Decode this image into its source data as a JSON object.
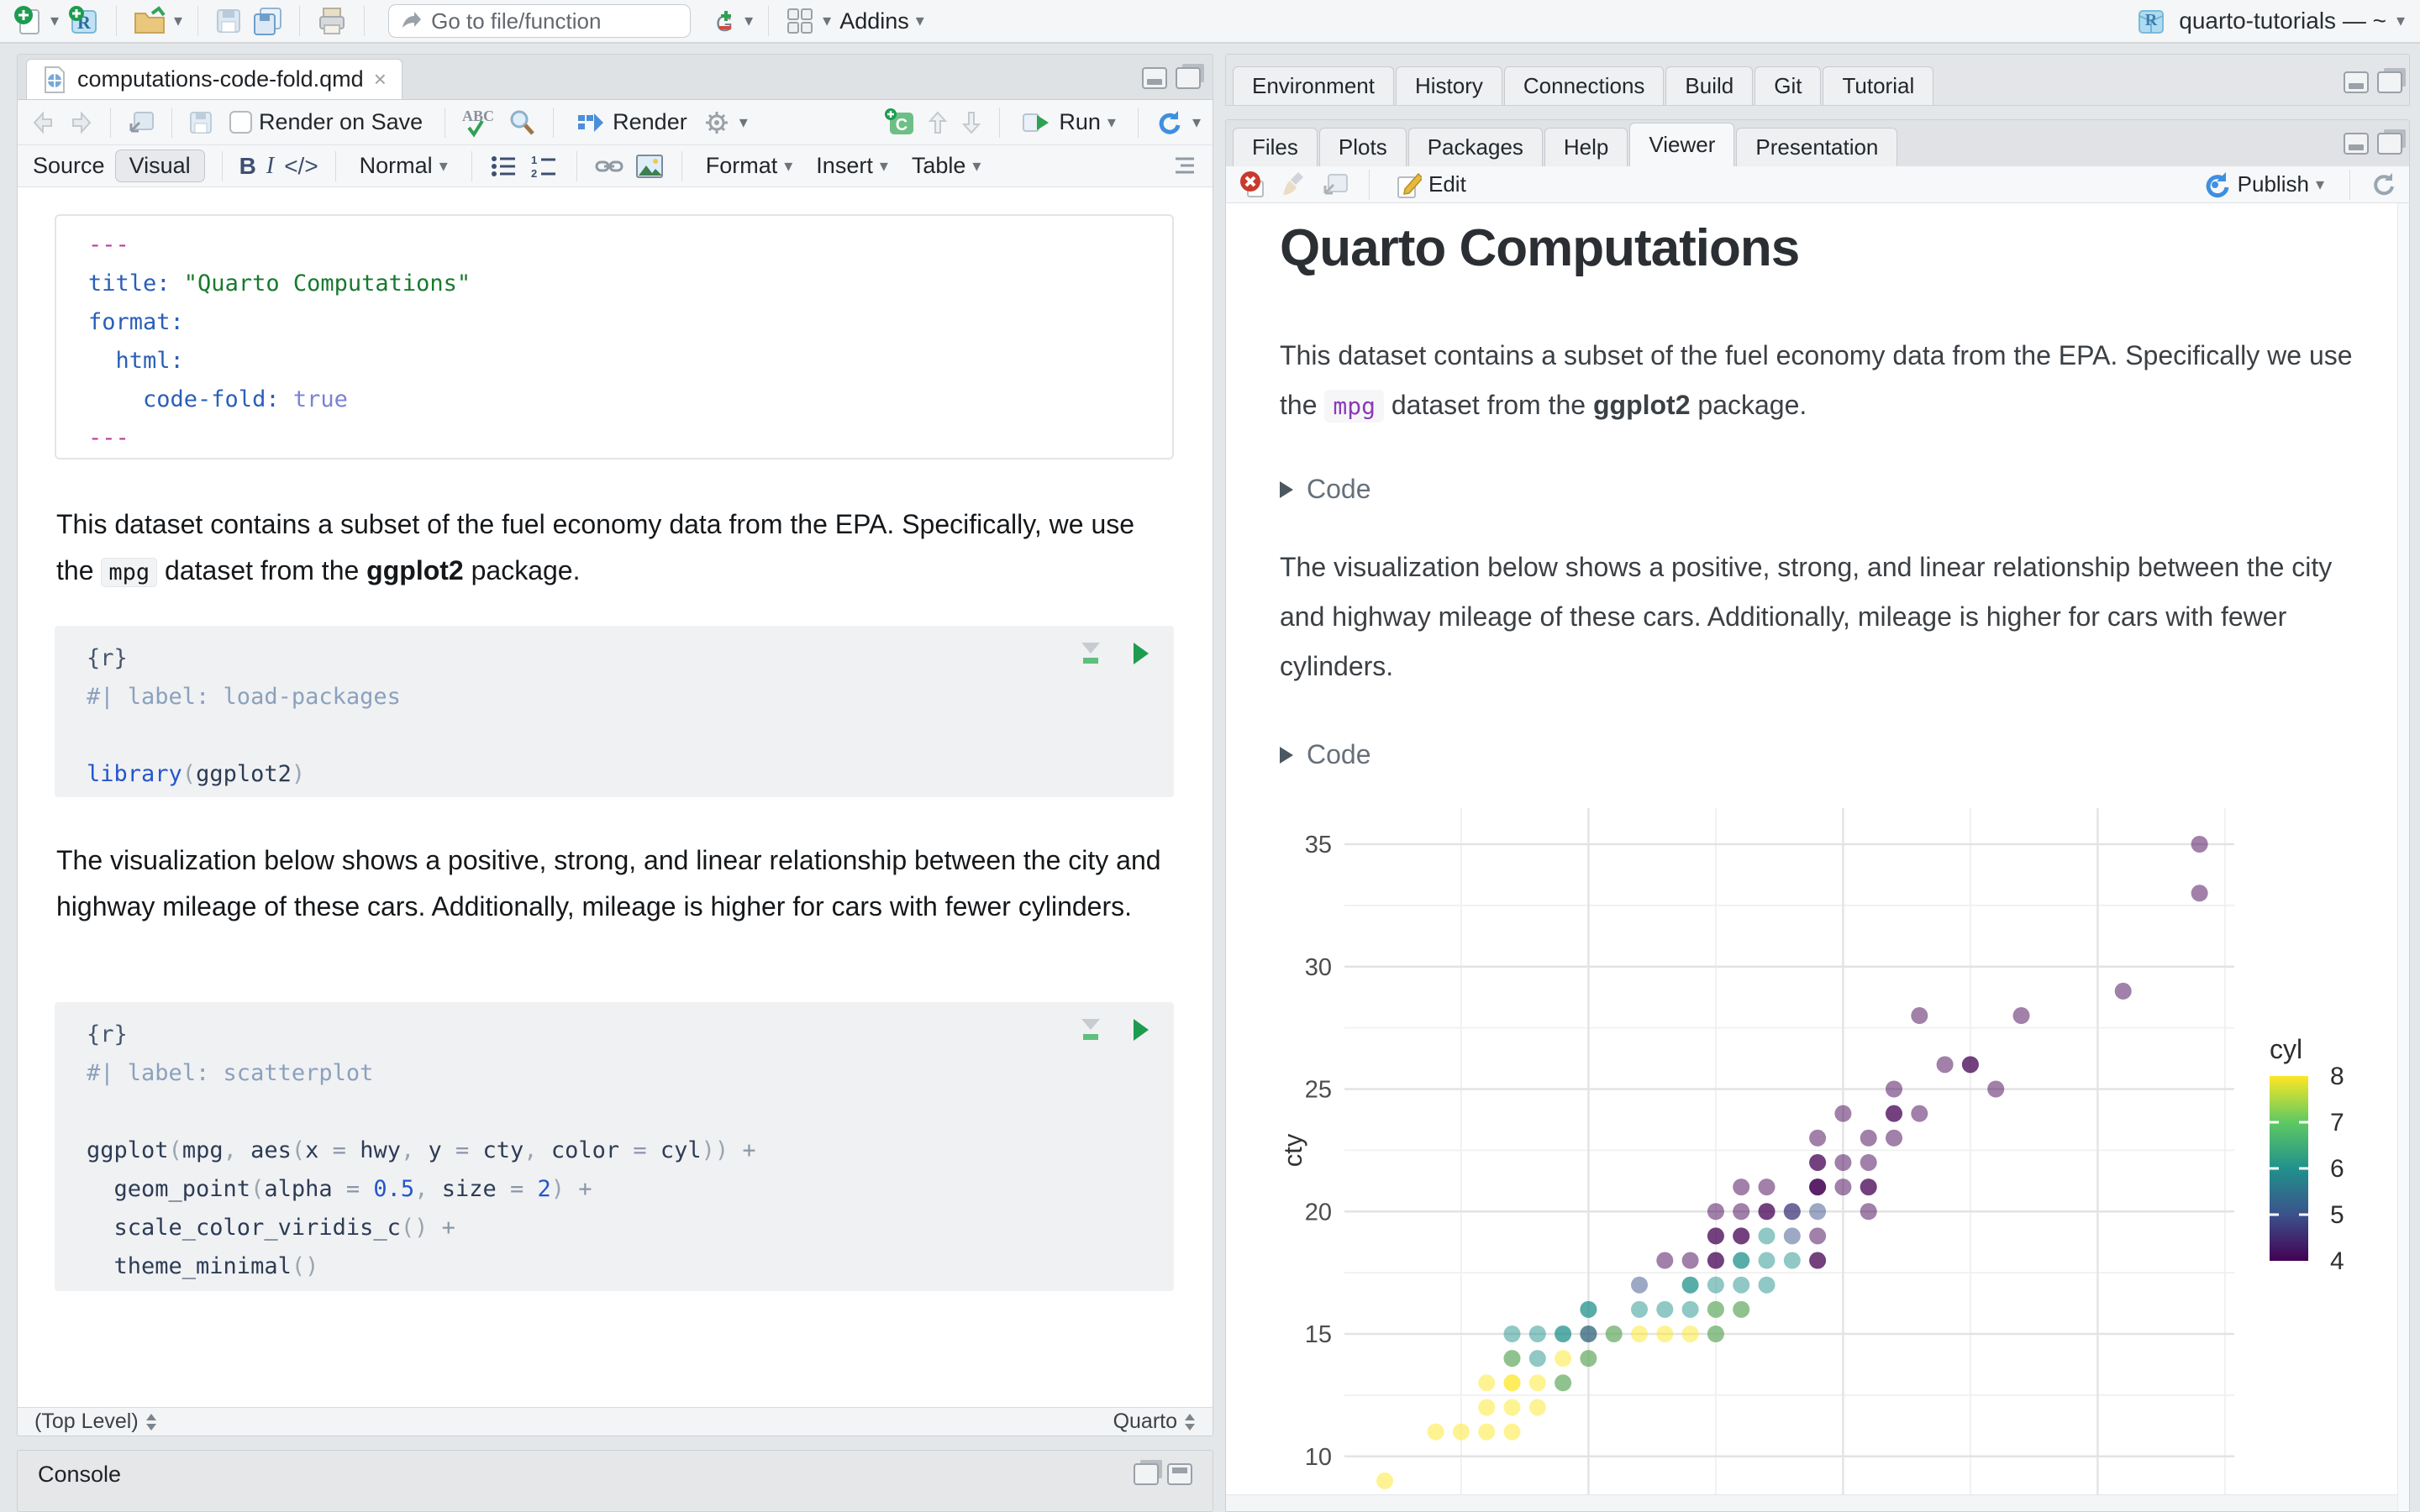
{
  "chrome": {
    "goto_placeholder": "Go to file/function",
    "addins_label": "Addins",
    "project_name": "quarto-tutorials — ~"
  },
  "editor": {
    "tab_title": "computations-code-fold.qmd",
    "render_on_save": "Render on Save",
    "render_label": "Render",
    "run_label": "Run",
    "source_label": "Source",
    "visual_label": "Visual",
    "normal_label": "Normal",
    "format_label": "Format",
    "insert_label": "Insert",
    "table_label": "Table",
    "yaml_lines": [
      [
        {
          "t": "---",
          "c": "delim"
        }
      ],
      [
        {
          "t": "title: ",
          "c": "key"
        },
        {
          "t": "\"Quarto Computations\"",
          "c": "str"
        }
      ],
      [
        {
          "t": "format:",
          "c": "key"
        }
      ],
      [
        {
          "t": "  html:",
          "c": "key"
        }
      ],
      [
        {
          "t": "    code-fold: ",
          "c": "key"
        },
        {
          "t": "true",
          "c": "bool"
        }
      ],
      [
        {
          "t": "---",
          "c": "delim"
        }
      ]
    ],
    "para1_segs": [
      {
        "t": "This dataset contains a subset of the fuel economy data from the EPA. Specifically, we use the "
      },
      {
        "t": "mpg",
        "c": "code"
      },
      {
        "t": " dataset from the "
      },
      {
        "t": "ggplot2",
        "c": "bold"
      },
      {
        "t": " package."
      }
    ],
    "chunk1_lines": [
      [
        {
          "t": "{r}",
          "c": "meta"
        }
      ],
      [
        {
          "t": "#| label: load-packages",
          "c": "comment"
        }
      ],
      [
        {
          "t": " ",
          "c": "id"
        }
      ],
      [
        {
          "t": "library",
          "c": "kw"
        },
        {
          "t": "(",
          "c": "paren"
        },
        {
          "t": "ggplot2",
          "c": "id"
        },
        {
          "t": ")",
          "c": "paren"
        }
      ]
    ],
    "para2": "The visualization below shows a positive, strong, and linear relationship between the city and highway mileage of these cars. Additionally, mileage is higher for cars with fewer cylinders.",
    "chunk2_lines": [
      [
        {
          "t": "{r}",
          "c": "meta"
        }
      ],
      [
        {
          "t": "#| label: scatterplot",
          "c": "comment"
        }
      ],
      [
        {
          "t": " ",
          "c": "id"
        }
      ],
      [
        {
          "t": "ggplot",
          "c": "id"
        },
        {
          "t": "(",
          "c": "paren"
        },
        {
          "t": "mpg",
          "c": "id"
        },
        {
          "t": ", ",
          "c": "paren"
        },
        {
          "t": "aes",
          "c": "id"
        },
        {
          "t": "(",
          "c": "paren"
        },
        {
          "t": "x ",
          "c": "id"
        },
        {
          "t": "= ",
          "c": "op"
        },
        {
          "t": "hwy",
          "c": "id"
        },
        {
          "t": ", ",
          "c": "paren"
        },
        {
          "t": "y ",
          "c": "id"
        },
        {
          "t": "= ",
          "c": "op"
        },
        {
          "t": "cty",
          "c": "id"
        },
        {
          "t": ", ",
          "c": "paren"
        },
        {
          "t": "color ",
          "c": "id"
        },
        {
          "t": "= ",
          "c": "op"
        },
        {
          "t": "cyl",
          "c": "id"
        },
        {
          "t": "))",
          "c": "paren"
        },
        {
          "t": " +",
          "c": "op"
        }
      ],
      [
        {
          "t": "  geom_point",
          "c": "id"
        },
        {
          "t": "(",
          "c": "paren"
        },
        {
          "t": "alpha ",
          "c": "id"
        },
        {
          "t": "= ",
          "c": "op"
        },
        {
          "t": "0.5",
          "c": "num"
        },
        {
          "t": ", ",
          "c": "paren"
        },
        {
          "t": "size ",
          "c": "id"
        },
        {
          "t": "= ",
          "c": "op"
        },
        {
          "t": "2",
          "c": "num"
        },
        {
          "t": ")",
          "c": "paren"
        },
        {
          "t": " +",
          "c": "op"
        }
      ],
      [
        {
          "t": "  scale_color_viridis_c",
          "c": "id"
        },
        {
          "t": "()",
          "c": "paren"
        },
        {
          "t": " +",
          "c": "op"
        }
      ],
      [
        {
          "t": "  theme_minimal",
          "c": "id"
        },
        {
          "t": "()",
          "c": "paren"
        }
      ]
    ],
    "status_left": "(Top Level)",
    "status_right": "Quarto",
    "console_title": "Console"
  },
  "right": {
    "top_tabs": [
      "Environment",
      "History",
      "Connections",
      "Build",
      "Git",
      "Tutorial"
    ],
    "bottom_tabs": [
      "Files",
      "Plots",
      "Packages",
      "Help",
      "Viewer",
      "Presentation"
    ],
    "active_tab": "Viewer",
    "edit_label": "Edit",
    "publish_label": "Publish",
    "page": {
      "title": "Quarto Computations",
      "para1_segs": [
        {
          "t": "This dataset contains a subset of the fuel economy data from the EPA. Specifically we use the "
        },
        {
          "t": "mpg",
          "c": "code"
        },
        {
          "t": " dataset from the "
        },
        {
          "t": "ggplot2",
          "c": "bold"
        },
        {
          "t": " package."
        }
      ],
      "fold_label": "Code",
      "para2": "The visualization below shows a positive, strong, and linear relationship between the city and highway mileage of these cars. Additionally, mileage is higher for cars with fewer cylinders."
    }
  },
  "chart_data": {
    "type": "scatter",
    "x_var": "hwy",
    "y_var": "cty",
    "color_var": "cyl",
    "ylabel": "cty",
    "alpha": 0.5,
    "point_size": 2,
    "y_ticks": [
      10,
      15,
      20,
      25,
      30,
      35
    ],
    "y_gridlines_major": [
      10,
      15,
      20,
      25,
      30,
      35
    ],
    "y_gridlines_minor": [
      12.5,
      17.5,
      22.5,
      27.5,
      32.5
    ],
    "x_gridlines_major": [
      20,
      30,
      40
    ],
    "x_gridlines_minor": [
      15,
      25,
      35,
      45
    ],
    "x_range_visible": [
      10.4,
      46.5
    ],
    "y_range_visible": [
      8.4,
      36.5
    ],
    "legend": {
      "title": "cyl",
      "labels": [
        8,
        7,
        6,
        5,
        4
      ],
      "ticks": [
        7,
        6,
        5
      ]
    },
    "viridis": {
      "4": "#440154",
      "5": "#3b528b",
      "6": "#21918c",
      "7": "#5ec962",
      "8": "#fde725"
    },
    "legend_gradient": [
      "#fde725",
      "#5ec962",
      "#21918c",
      "#3b528b",
      "#440154"
    ],
    "points": [
      [
        12,
        9,
        [
          8
        ]
      ],
      [
        14,
        11,
        [
          8
        ]
      ],
      [
        15,
        11,
        [
          8
        ]
      ],
      [
        16,
        11,
        [
          8
        ]
      ],
      [
        17,
        11,
        [
          8
        ]
      ],
      [
        16,
        12,
        [
          8
        ]
      ],
      [
        17,
        12,
        [
          8
        ]
      ],
      [
        18,
        12,
        [
          8
        ]
      ],
      [
        16,
        13,
        [
          8
        ]
      ],
      [
        17,
        13,
        [
          8,
          8
        ]
      ],
      [
        18,
        13,
        [
          8
        ]
      ],
      [
        19,
        13,
        [
          8,
          6
        ]
      ],
      [
        17,
        14,
        [
          8,
          6
        ]
      ],
      [
        18,
        14,
        [
          6
        ]
      ],
      [
        19,
        14,
        [
          8
        ]
      ],
      [
        20,
        14,
        [
          8,
          6
        ]
      ],
      [
        17,
        15,
        [
          6
        ]
      ],
      [
        18,
        15,
        [
          6
        ]
      ],
      [
        19,
        15,
        [
          6,
          6
        ]
      ],
      [
        20,
        15,
        [
          4,
          6
        ]
      ],
      [
        21,
        15,
        [
          8,
          6
        ]
      ],
      [
        22,
        15,
        [
          8
        ]
      ],
      [
        23,
        15,
        [
          8
        ]
      ],
      [
        24,
        15,
        [
          8
        ]
      ],
      [
        25,
        15,
        [
          8,
          6
        ]
      ],
      [
        20,
        16,
        [
          6,
          6
        ]
      ],
      [
        22,
        16,
        [
          6
        ]
      ],
      [
        23,
        16,
        [
          6
        ]
      ],
      [
        24,
        16,
        [
          6
        ]
      ],
      [
        25,
        16,
        [
          8,
          6
        ]
      ],
      [
        26,
        16,
        [
          8,
          6
        ]
      ],
      [
        22,
        17,
        [
          5
        ]
      ],
      [
        24,
        17,
        [
          6,
          6
        ]
      ],
      [
        25,
        17,
        [
          6
        ]
      ],
      [
        26,
        17,
        [
          6
        ]
      ],
      [
        27,
        17,
        [
          6
        ]
      ],
      [
        23,
        18,
        [
          4
        ]
      ],
      [
        24,
        18,
        [
          4
        ]
      ],
      [
        25,
        18,
        [
          4,
          4
        ]
      ],
      [
        26,
        18,
        [
          6,
          6
        ]
      ],
      [
        27,
        18,
        [
          6
        ]
      ],
      [
        28,
        18,
        [
          6
        ]
      ],
      [
        29,
        18,
        [
          4,
          4
        ]
      ],
      [
        25,
        19,
        [
          4,
          4
        ]
      ],
      [
        26,
        19,
        [
          4,
          4
        ]
      ],
      [
        27,
        19,
        [
          6
        ]
      ],
      [
        28,
        19,
        [
          5
        ]
      ],
      [
        29,
        19,
        [
          4
        ]
      ],
      [
        25,
        20,
        [
          4
        ]
      ],
      [
        26,
        20,
        [
          4
        ]
      ],
      [
        27,
        20,
        [
          4,
          4
        ]
      ],
      [
        28,
        20,
        [
          4,
          5
        ]
      ],
      [
        29,
        20,
        [
          5
        ]
      ],
      [
        31,
        20,
        [
          4
        ]
      ],
      [
        26,
        21,
        [
          4
        ]
      ],
      [
        27,
        21,
        [
          4
        ]
      ],
      [
        29,
        21,
        [
          4,
          4,
          4
        ]
      ],
      [
        30,
        21,
        [
          4
        ]
      ],
      [
        31,
        21,
        [
          4,
          4
        ]
      ],
      [
        29,
        22,
        [
          4,
          4
        ]
      ],
      [
        30,
        22,
        [
          4
        ]
      ],
      [
        31,
        22,
        [
          4
        ]
      ],
      [
        29,
        23,
        [
          4
        ]
      ],
      [
        31,
        23,
        [
          4
        ]
      ],
      [
        32,
        23,
        [
          4
        ]
      ],
      [
        30,
        24,
        [
          4
        ]
      ],
      [
        32,
        24,
        [
          4,
          4
        ]
      ],
      [
        33,
        24,
        [
          4
        ]
      ],
      [
        32,
        25,
        [
          4
        ]
      ],
      [
        36,
        25,
        [
          4
        ]
      ],
      [
        34,
        26,
        [
          4
        ]
      ],
      [
        35,
        26,
        [
          4,
          4
        ]
      ],
      [
        33,
        28,
        [
          4
        ]
      ],
      [
        37,
        28,
        [
          4
        ]
      ],
      [
        41,
        29,
        [
          4
        ]
      ],
      [
        44,
        33,
        [
          4
        ]
      ],
      [
        44,
        35,
        [
          4
        ]
      ]
    ]
  }
}
